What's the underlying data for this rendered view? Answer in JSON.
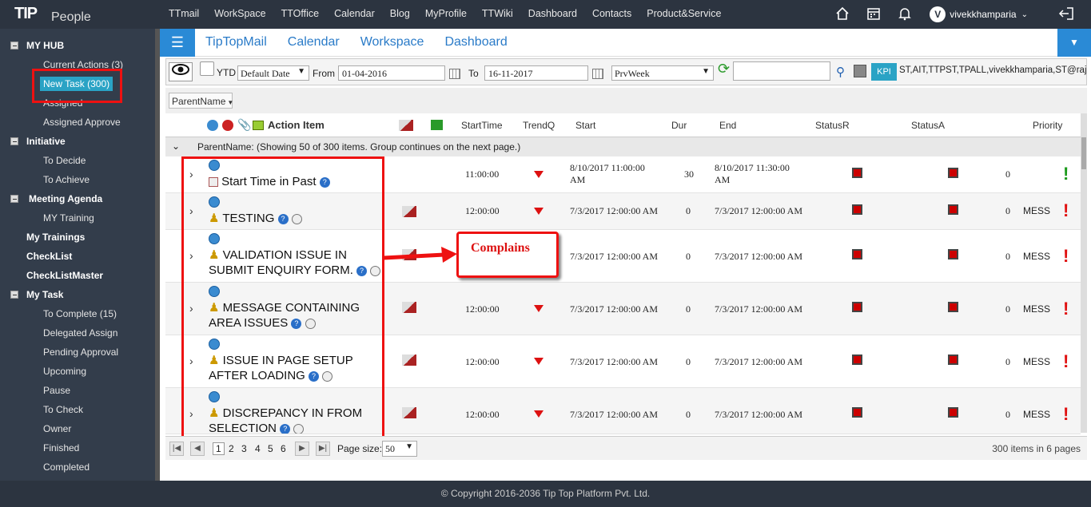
{
  "app": {
    "logo": "TIP",
    "logo_sub": "People"
  },
  "topnav": [
    "TTmail",
    "WorkSpace",
    "TTOffice",
    "Calendar",
    "Blog",
    "MyProfile",
    "TTWiki",
    "Dashboard",
    "Contacts",
    "Product&Service"
  ],
  "user": {
    "initial": "V",
    "name": "vivekkhamparia"
  },
  "sidebar": {
    "my_hub": "MY HUB",
    "current_actions": "Current Actions (3)",
    "new_task": "New Task (300)",
    "assigned": "Assigned",
    "assigned_approve": "Assigned Approve",
    "initiative": "Initiative",
    "to_decide": "To Decide",
    "to_achieve": "To Achieve",
    "meeting_agenda": "Meeting Agenda",
    "my_training": "MY Training",
    "my_trainings": "My Trainings",
    "checklist": "CheckList",
    "checklist_master": "CheckListMaster",
    "my_task": "My Task",
    "to_complete": "To Complete (15)",
    "delegated_assign": "Delegated Assign",
    "pending_approval": "Pending Approval",
    "upcoming": "Upcoming",
    "pause": "Pause",
    "to_check": "To Check",
    "owner": "Owner",
    "finished": "Finished",
    "completed": "Completed"
  },
  "subnav": [
    "TipTopMail",
    "Calendar",
    "Workspace",
    "Dashboard"
  ],
  "toolbar": {
    "ytd": "YTD",
    "default_date": "Default Date",
    "from_label": "From",
    "from": "01-04-2016",
    "to_label": "To",
    "to": "16-11-2017",
    "period": "PrvWeek",
    "kpi": "KPI",
    "filter": "ST,AIT,TTPST,TPALL,vivekkhamparia,ST@rajp"
  },
  "group_button": "ParentName",
  "headers": {
    "action_item": "Action Item",
    "start_time": "StartTime",
    "trend": "TrendQ",
    "start": "Start",
    "dur": "Dur",
    "end": "End",
    "status_r": "StatusR",
    "status_a": "StatusA",
    "priority": "Priority"
  },
  "group_row": "ParentName: (Showing 50 of 300 items. Group continues on the next page.)",
  "rows": [
    {
      "title": "Start Time in Past",
      "start_time": "11:00:00",
      "start": "8/10/2017 11:00:00 AM",
      "dur": "30",
      "end": "8/10/2017 11:30:00 AM",
      "count": "0",
      "mess": "",
      "priority_color": "#1a9a1a"
    },
    {
      "title": "TESTING",
      "start_time": "12:00:00",
      "start": "7/3/2017 12:00:00 AM",
      "dur": "0",
      "end": "7/3/2017 12:00:00 AM",
      "count": "0",
      "mess": "MESS",
      "priority_color": "#e01010"
    },
    {
      "title": "VALIDATION ISSUE IN SUBMIT ENQUIRY FORM.",
      "start_time": "12:00:00",
      "start": "7/3/2017 12:00:00 AM",
      "dur": "0",
      "end": "7/3/2017 12:00:00 AM",
      "count": "0",
      "mess": "MESS",
      "priority_color": "#e01010"
    },
    {
      "title": "MESSAGE CONTAINING AREA ISSUES",
      "start_time": "12:00:00",
      "start": "7/3/2017 12:00:00 AM",
      "dur": "0",
      "end": "7/3/2017 12:00:00 AM",
      "count": "0",
      "mess": "MESS",
      "priority_color": "#e01010"
    },
    {
      "title": "ISSUE IN PAGE SETUP AFTER LOADING",
      "start_time": "12:00:00",
      "start": "7/3/2017 12:00:00 AM",
      "dur": "0",
      "end": "7/3/2017 12:00:00 AM",
      "count": "0",
      "mess": "MESS",
      "priority_color": "#e01010"
    },
    {
      "title": "DISCREPANCY IN FROM SELECTION",
      "start_time": "12:00:00",
      "start": "7/3/2017 12:00:00 AM",
      "dur": "0",
      "end": "7/3/2017 12:00:00 AM",
      "count": "0",
      "mess": "MESS",
      "priority_color": "#e01010"
    }
  ],
  "callout": "Complains",
  "pager": {
    "pages": [
      "1",
      "2",
      "3",
      "4",
      "5",
      "6"
    ],
    "page_size_label": "Page size:",
    "page_size": "50",
    "summary": "300 items in 6 pages"
  },
  "footer": "© Copyright 2016-2036 Tip Top Platform Pvt. Ltd."
}
